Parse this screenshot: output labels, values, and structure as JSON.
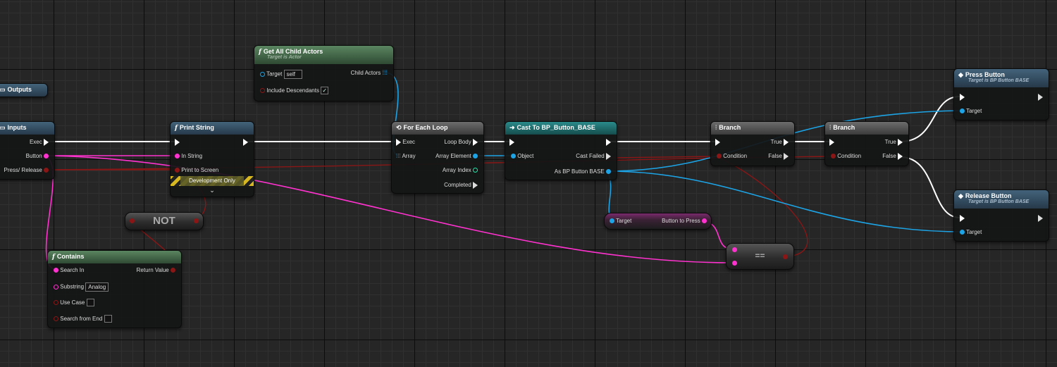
{
  "colors": {
    "exec": "#ffffff",
    "string": "#ff32cf",
    "bool": "#b51a1a",
    "object": "#1ca4e6",
    "int": "#25e3a6"
  },
  "outputs_node": {
    "title": "Outputs"
  },
  "inputs_node": {
    "title": "Inputs",
    "pins": [
      "Exec",
      "Button",
      "Press/ Release"
    ]
  },
  "print_node": {
    "title": "Print String",
    "pins": [
      "In String",
      "Print to Screen"
    ],
    "dev": "Development Only",
    "expand": "⌄"
  },
  "not_node": {
    "label": "NOT"
  },
  "contains_node": {
    "title": "Contains",
    "pins": [
      "Search In",
      "Substring",
      "Use Case",
      "Search from End"
    ],
    "substring": "Analog",
    "ret": "Return Value"
  },
  "gaca_node": {
    "title": "Get All Child Actors",
    "subtitle": "Target is Actor",
    "target": "Target",
    "self": "self",
    "include": "Include Descendants",
    "child": "Child Actors"
  },
  "foreach_node": {
    "title": "For Each Loop",
    "inputs": [
      "Exec",
      "Array"
    ],
    "outputs": [
      "Loop Body",
      "Array Element",
      "Array Index",
      "Completed"
    ]
  },
  "cast_node": {
    "title": "Cast To BP_Button_BASE",
    "input": "Object",
    "outputs": [
      "Cast Failed",
      "As BP Button BASE"
    ]
  },
  "getvar_node": {
    "target": "Target",
    "output": "Button to Press"
  },
  "eq_node": {
    "label": "=="
  },
  "branch1": {
    "title": "Branch",
    "cond": "Condition",
    "true": "True",
    "false": "False"
  },
  "branch2": {
    "title": "Branch",
    "cond": "Condition",
    "true": "True",
    "false": "False"
  },
  "press_node": {
    "title": "Press Button",
    "subtitle": "Target is BP Button BASE",
    "target": "Target"
  },
  "release_node": {
    "title": "Release Button",
    "subtitle": "Target is BP Button BASE",
    "target": "Target"
  }
}
